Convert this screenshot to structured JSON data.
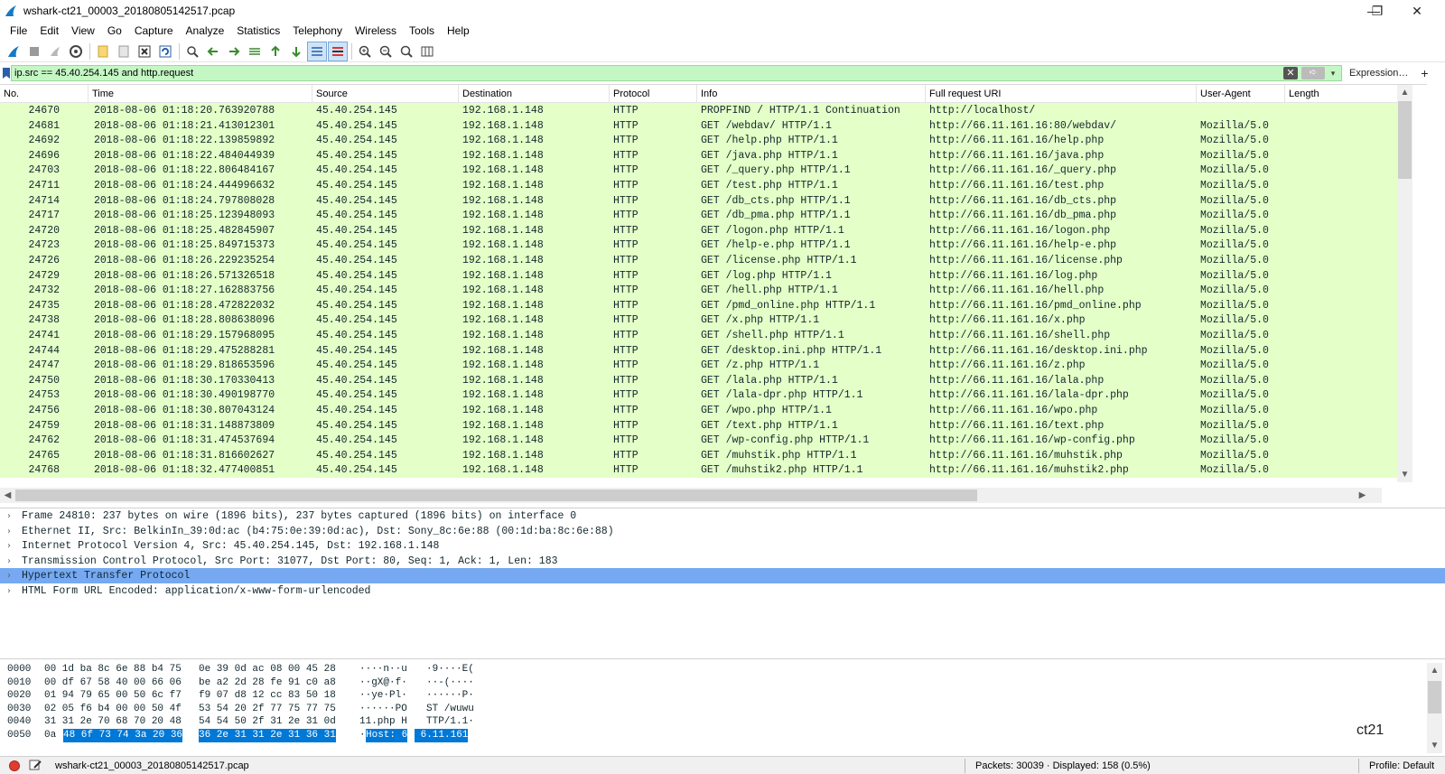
{
  "window": {
    "title": "wshark-ct21_00003_20180805142517.pcap",
    "minimize_glyph": "—",
    "maximize_glyph": "❐",
    "close_glyph": "✕"
  },
  "menu": [
    "File",
    "Edit",
    "View",
    "Go",
    "Capture",
    "Analyze",
    "Statistics",
    "Telephony",
    "Wireless",
    "Tools",
    "Help"
  ],
  "toolbar": {
    "icons": [
      "shark-fin-start-icon",
      "stop-capture-icon",
      "restart-capture-icon",
      "capture-options-icon",
      "open-file-icon",
      "save-file-icon",
      "close-file-icon",
      "reload-file-icon",
      "find-packet-icon",
      "go-back-icon",
      "go-forward-icon",
      "go-to-packet-icon",
      "go-first-icon",
      "go-last-icon",
      "auto-scroll-icon",
      "colorize-icon",
      "zoom-in-icon",
      "zoom-out-icon",
      "zoom-normal-icon",
      "resize-columns-icon"
    ]
  },
  "filter": {
    "value": "ip.src == 45.40.254.145 and http.request",
    "clear_glyph": "✕",
    "apply_glyph": "➪",
    "history_glyph": "▾",
    "expression_label": "Expression…",
    "add_glyph": "+",
    "bg_color": "#c5f7c5"
  },
  "packet_list": {
    "columns": [
      "No.",
      "Time",
      "Source",
      "Destination",
      "Protocol",
      "Info",
      "Full request URI",
      "User-Agent",
      "Length"
    ],
    "row_color": "#e4ffc7",
    "rows": [
      {
        "no": "24670",
        "time": "2018-08-06 01:18:20.763920788",
        "src": "45.40.254.145",
        "dst": "192.168.1.148",
        "proto": "HTTP",
        "info": "PROPFIND / HTTP/1.1 Continuation",
        "uri": "http://localhost/",
        "ua": ""
      },
      {
        "no": "24681",
        "time": "2018-08-06 01:18:21.413012301",
        "src": "45.40.254.145",
        "dst": "192.168.1.148",
        "proto": "HTTP",
        "info": "GET /webdav/ HTTP/1.1",
        "uri": "http://66.11.161.16:80/webdav/",
        "ua": "Mozilla/5.0"
      },
      {
        "no": "24692",
        "time": "2018-08-06 01:18:22.139859892",
        "src": "45.40.254.145",
        "dst": "192.168.1.148",
        "proto": "HTTP",
        "info": "GET /help.php HTTP/1.1",
        "uri": "http://66.11.161.16/help.php",
        "ua": "Mozilla/5.0"
      },
      {
        "no": "24696",
        "time": "2018-08-06 01:18:22.484044939",
        "src": "45.40.254.145",
        "dst": "192.168.1.148",
        "proto": "HTTP",
        "info": "GET /java.php HTTP/1.1",
        "uri": "http://66.11.161.16/java.php",
        "ua": "Mozilla/5.0"
      },
      {
        "no": "24703",
        "time": "2018-08-06 01:18:22.806484167",
        "src": "45.40.254.145",
        "dst": "192.168.1.148",
        "proto": "HTTP",
        "info": "GET /_query.php HTTP/1.1",
        "uri": "http://66.11.161.16/_query.php",
        "ua": "Mozilla/5.0"
      },
      {
        "no": "24711",
        "time": "2018-08-06 01:18:24.444996632",
        "src": "45.40.254.145",
        "dst": "192.168.1.148",
        "proto": "HTTP",
        "info": "GET /test.php HTTP/1.1",
        "uri": "http://66.11.161.16/test.php",
        "ua": "Mozilla/5.0"
      },
      {
        "no": "24714",
        "time": "2018-08-06 01:18:24.797808028",
        "src": "45.40.254.145",
        "dst": "192.168.1.148",
        "proto": "HTTP",
        "info": "GET /db_cts.php HTTP/1.1",
        "uri": "http://66.11.161.16/db_cts.php",
        "ua": "Mozilla/5.0"
      },
      {
        "no": "24717",
        "time": "2018-08-06 01:18:25.123948093",
        "src": "45.40.254.145",
        "dst": "192.168.1.148",
        "proto": "HTTP",
        "info": "GET /db_pma.php HTTP/1.1",
        "uri": "http://66.11.161.16/db_pma.php",
        "ua": "Mozilla/5.0"
      },
      {
        "no": "24720",
        "time": "2018-08-06 01:18:25.482845907",
        "src": "45.40.254.145",
        "dst": "192.168.1.148",
        "proto": "HTTP",
        "info": "GET /logon.php HTTP/1.1",
        "uri": "http://66.11.161.16/logon.php",
        "ua": "Mozilla/5.0"
      },
      {
        "no": "24723",
        "time": "2018-08-06 01:18:25.849715373",
        "src": "45.40.254.145",
        "dst": "192.168.1.148",
        "proto": "HTTP",
        "info": "GET /help-e.php HTTP/1.1",
        "uri": "http://66.11.161.16/help-e.php",
        "ua": "Mozilla/5.0"
      },
      {
        "no": "24726",
        "time": "2018-08-06 01:18:26.229235254",
        "src": "45.40.254.145",
        "dst": "192.168.1.148",
        "proto": "HTTP",
        "info": "GET /license.php HTTP/1.1",
        "uri": "http://66.11.161.16/license.php",
        "ua": "Mozilla/5.0"
      },
      {
        "no": "24729",
        "time": "2018-08-06 01:18:26.571326518",
        "src": "45.40.254.145",
        "dst": "192.168.1.148",
        "proto": "HTTP",
        "info": "GET /log.php HTTP/1.1",
        "uri": "http://66.11.161.16/log.php",
        "ua": "Mozilla/5.0"
      },
      {
        "no": "24732",
        "time": "2018-08-06 01:18:27.162883756",
        "src": "45.40.254.145",
        "dst": "192.168.1.148",
        "proto": "HTTP",
        "info": "GET /hell.php HTTP/1.1",
        "uri": "http://66.11.161.16/hell.php",
        "ua": "Mozilla/5.0"
      },
      {
        "no": "24735",
        "time": "2018-08-06 01:18:28.472822032",
        "src": "45.40.254.145",
        "dst": "192.168.1.148",
        "proto": "HTTP",
        "info": "GET /pmd_online.php HTTP/1.1",
        "uri": "http://66.11.161.16/pmd_online.php",
        "ua": "Mozilla/5.0"
      },
      {
        "no": "24738",
        "time": "2018-08-06 01:18:28.808638096",
        "src": "45.40.254.145",
        "dst": "192.168.1.148",
        "proto": "HTTP",
        "info": "GET /x.php HTTP/1.1",
        "uri": "http://66.11.161.16/x.php",
        "ua": "Mozilla/5.0"
      },
      {
        "no": "24741",
        "time": "2018-08-06 01:18:29.157968095",
        "src": "45.40.254.145",
        "dst": "192.168.1.148",
        "proto": "HTTP",
        "info": "GET /shell.php HTTP/1.1",
        "uri": "http://66.11.161.16/shell.php",
        "ua": "Mozilla/5.0"
      },
      {
        "no": "24744",
        "time": "2018-08-06 01:18:29.475288281",
        "src": "45.40.254.145",
        "dst": "192.168.1.148",
        "proto": "HTTP",
        "info": "GET /desktop.ini.php HTTP/1.1",
        "uri": "http://66.11.161.16/desktop.ini.php",
        "ua": "Mozilla/5.0"
      },
      {
        "no": "24747",
        "time": "2018-08-06 01:18:29.818653596",
        "src": "45.40.254.145",
        "dst": "192.168.1.148",
        "proto": "HTTP",
        "info": "GET /z.php HTTP/1.1",
        "uri": "http://66.11.161.16/z.php",
        "ua": "Mozilla/5.0"
      },
      {
        "no": "24750",
        "time": "2018-08-06 01:18:30.170330413",
        "src": "45.40.254.145",
        "dst": "192.168.1.148",
        "proto": "HTTP",
        "info": "GET /lala.php HTTP/1.1",
        "uri": "http://66.11.161.16/lala.php",
        "ua": "Mozilla/5.0"
      },
      {
        "no": "24753",
        "time": "2018-08-06 01:18:30.490198770",
        "src": "45.40.254.145",
        "dst": "192.168.1.148",
        "proto": "HTTP",
        "info": "GET /lala-dpr.php HTTP/1.1",
        "uri": "http://66.11.161.16/lala-dpr.php",
        "ua": "Mozilla/5.0"
      },
      {
        "no": "24756",
        "time": "2018-08-06 01:18:30.807043124",
        "src": "45.40.254.145",
        "dst": "192.168.1.148",
        "proto": "HTTP",
        "info": "GET /wpo.php HTTP/1.1",
        "uri": "http://66.11.161.16/wpo.php",
        "ua": "Mozilla/5.0"
      },
      {
        "no": "24759",
        "time": "2018-08-06 01:18:31.148873809",
        "src": "45.40.254.145",
        "dst": "192.168.1.148",
        "proto": "HTTP",
        "info": "GET /text.php HTTP/1.1",
        "uri": "http://66.11.161.16/text.php",
        "ua": "Mozilla/5.0"
      },
      {
        "no": "24762",
        "time": "2018-08-06 01:18:31.474537694",
        "src": "45.40.254.145",
        "dst": "192.168.1.148",
        "proto": "HTTP",
        "info": "GET /wp-config.php HTTP/1.1",
        "uri": "http://66.11.161.16/wp-config.php",
        "ua": "Mozilla/5.0"
      },
      {
        "no": "24765",
        "time": "2018-08-06 01:18:31.816602627",
        "src": "45.40.254.145",
        "dst": "192.168.1.148",
        "proto": "HTTP",
        "info": "GET /muhstik.php HTTP/1.1",
        "uri": "http://66.11.161.16/muhstik.php",
        "ua": "Mozilla/5.0"
      },
      {
        "no": "24768",
        "time": "2018-08-06 01:18:32.477400851",
        "src": "45.40.254.145",
        "dst": "192.168.1.148",
        "proto": "HTTP",
        "info": "GET /muhstik2.php HTTP/1.1",
        "uri": "http://66.11.161.16/muhstik2.php",
        "ua": "Mozilla/5.0"
      }
    ]
  },
  "details": {
    "rows": [
      {
        "text": "Frame 24810: 237 bytes on wire (1896 bits), 237 bytes captured (1896 bits) on interface 0",
        "selected": false
      },
      {
        "text": "Ethernet II, Src: BelkinIn_39:0d:ac (b4:75:0e:39:0d:ac), Dst: Sony_8c:6e:88 (00:1d:ba:8c:6e:88)",
        "selected": false
      },
      {
        "text": "Internet Protocol Version 4, Src: 45.40.254.145, Dst: 192.168.1.148",
        "selected": false
      },
      {
        "text": "Transmission Control Protocol, Src Port: 31077, Dst Port: 80, Seq: 1, Ack: 1, Len: 183",
        "selected": false
      },
      {
        "text": "Hypertext Transfer Protocol",
        "selected": true
      },
      {
        "text": "HTML Form URL Encoded: application/x-www-form-urlencoded",
        "selected": false
      }
    ],
    "chevron": "›",
    "selected_color": "#76a9f2"
  },
  "bytes": {
    "rows": [
      {
        "offset": "0000",
        "hex1": "00 1d ba 8c 6e 88 b4 75",
        "hex2": "0e 39 0d ac 08 00 45 28",
        "ascii1": "····n··u",
        "ascii2": "·9····E("
      },
      {
        "offset": "0010",
        "hex1": "00 df 67 58 40 00 66 06",
        "hex2": "be a2 2d 28 fe 91 c0 a8",
        "ascii1": "··gX@·f·",
        "ascii2": "··-(····"
      },
      {
        "offset": "0020",
        "hex1": "01 94 79 65 00 50 6c f7",
        "hex2": "f9 07 d8 12 cc 83 50 18",
        "ascii1": "··ye·Pl·",
        "ascii2": "······P·"
      },
      {
        "offset": "0030",
        "hex1": "02 05 f6 b4 00 00 50 4f",
        "hex2": "53 54 20 2f 77 75 77 75",
        "ascii1": "······PO",
        "ascii2": "ST /wuwu"
      },
      {
        "offset": "0040",
        "hex1": "31 31 2e 70 68 70 20 48",
        "hex2": "54 54 50 2f 31 2e 31 0d",
        "ascii1": "11.php H",
        "ascii2": "TTP/1.1·"
      },
      {
        "offset": "0050",
        "hex1_plain": "0a ",
        "hex1_sel": "48 6f 73 74 3a 20 36",
        "hex2_sel": "36 2e 31 31 2e 31 36 31",
        "ascii1_plain": "·",
        "ascii1_sel": "Host: 6",
        "ascii2_sel": " 6.11.161"
      }
    ],
    "selection_color": "#0078d7"
  },
  "watermark": "ct21",
  "status": {
    "file": "wshark-ct21_00003_20180805142517.pcap",
    "packets": "Packets: 30039 · Displayed: 158 (0.5%)",
    "profile": "Profile: Default",
    "indicator_color": "#e03c31"
  }
}
